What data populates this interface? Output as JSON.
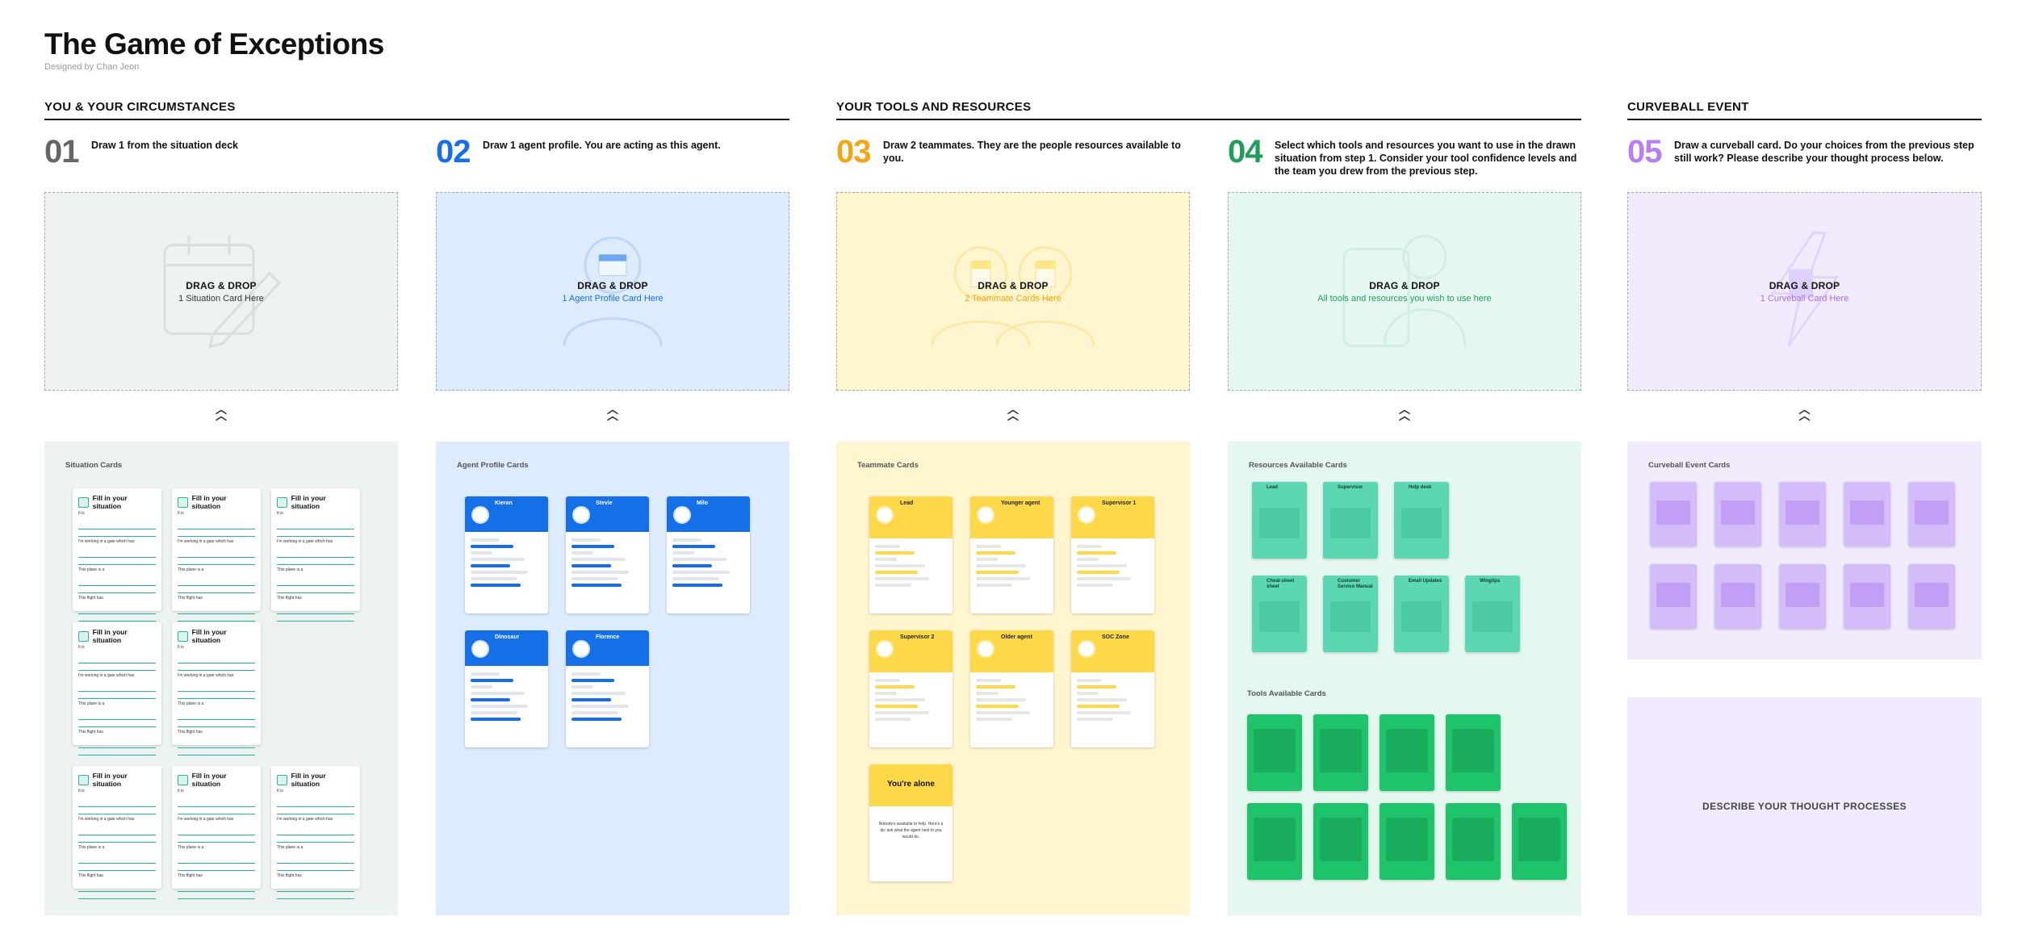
{
  "title": "The Game of Exceptions",
  "subtitle": "Designed by Chan Jeon",
  "sections": [
    {
      "label": "YOU & YOUR CIRCUMSTANCES"
    },
    {
      "label": "YOUR TOOLS AND RESOURCES"
    },
    {
      "label": "CURVEBALL EVENT"
    }
  ],
  "steps": [
    {
      "num": "01",
      "text": "Draw 1 from the situation deck",
      "color": "#666666",
      "drop_title": "DRAG & DROP",
      "drop_sub": "1 Situation Card Here",
      "drop_sub_color": "#333333",
      "drop_bg": "#eef3f2",
      "panel_label": "Situation Cards",
      "panel_bg": "#ecf3f1"
    },
    {
      "num": "02",
      "text": "Draw 1 agent profile. You are acting as this agent.",
      "color": "#1570e8",
      "drop_title": "DRAG & DROP",
      "drop_sub": "1 Agent Profile Card Here",
      "drop_sub_color": "#1570e8",
      "drop_bg": "#dcecfd",
      "panel_label": "Agent Profile Cards",
      "panel_bg": "#dcecfd"
    },
    {
      "num": "03",
      "text": "Draw 2 teammates. They are the people resources available to you.",
      "color": "#f5a512",
      "drop_title": "DRAG & DROP",
      "drop_sub": "2 Teammate Cards Here",
      "drop_sub_color": "#f5a512",
      "drop_bg": "#fff6cf",
      "panel_label": "Teammate Cards",
      "panel_bg": "#fff6cf"
    },
    {
      "num": "04",
      "text": "Select which tools and resources you want to use in the drawn situation from step 1. Consider your tool confidence levels and the team you drew from the previous step.",
      "color": "#1e9e5a",
      "drop_title": "DRAG & DROP",
      "drop_sub": "All tools and resources you wish to use here",
      "drop_sub_color": "#1e9e5a",
      "drop_bg": "#e4f8ef",
      "panel_label": "Resources Available Cards",
      "panel_bg": "#e4f8ef"
    },
    {
      "num": "05",
      "text": "Draw a curveball card. Do your choices from the previous step still work? Please describe your thought process below.",
      "color": "#b57ef5",
      "drop_title": "DRAG & DROP",
      "drop_sub": "1 Curveball Card Here",
      "drop_sub_color": "#a56ef0",
      "drop_bg": "#f2ebfe",
      "panel_label": "Curveball Event Cards",
      "panel_bg": "#f2ebfe"
    }
  ],
  "situation_card": {
    "title": "Fill in your situation",
    "line1": "It is",
    "line2": "I'm working in a gate which has",
    "line3": "This plane is a",
    "line4": "This flight has"
  },
  "agents": [
    "Kieran",
    "Stevie",
    "Milo",
    "Dinosaur",
    "Florence"
  ],
  "teammates": [
    "Lead",
    "Younger agent",
    "Supervisor 1",
    "Supervisor 2",
    "Older agent",
    "SOC Zone"
  ],
  "alone_card": {
    "title": "You're alone",
    "body": "Nobody's available to help. Here's a tip: ask what the agent next to you would do."
  },
  "resources": [
    "Lead",
    "Supervisor",
    "Help desk",
    "Cheat-sheet sheet",
    "Customer Service Manual",
    "Email Updates",
    "Wingtips"
  ],
  "tools_label": "Tools Available Cards",
  "describe_label": "DESCRIBE YOUR THOUGHT PROCESSES"
}
